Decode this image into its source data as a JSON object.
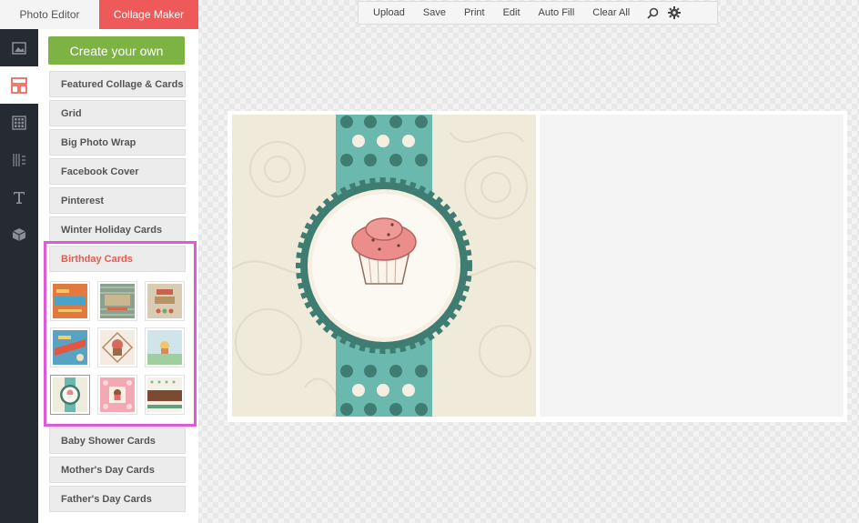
{
  "mode_tabs": {
    "photo_editor": "Photo Editor",
    "collage_maker": "Collage Maker"
  },
  "toolbar": {
    "upload": "Upload",
    "save": "Save",
    "print": "Print",
    "edit": "Edit",
    "auto_fill": "Auto Fill",
    "clear_all": "Clear All"
  },
  "icon_rail": [
    "image-icon",
    "layout-icon",
    "grid-pattern-icon",
    "texture-icon",
    "text-icon",
    "cube-icon"
  ],
  "sidebar": {
    "create_label": "Create your own",
    "categories_top": [
      "Featured Collage & Cards",
      "Grid",
      "Big Photo Wrap",
      "Facebook Cover",
      "Pinterest",
      "Winter Holiday Cards"
    ],
    "active_category": "Birthday Cards",
    "categories_bottom": [
      "Baby Shower Cards",
      "Mother's Day Cards",
      "Father's Day Cards"
    ]
  },
  "colors": {
    "accent": "#ee5a5a",
    "create_green": "#7cb342",
    "highlight": "#df5ad8",
    "teal": "#6bb8ae",
    "cream": "#efeada"
  }
}
